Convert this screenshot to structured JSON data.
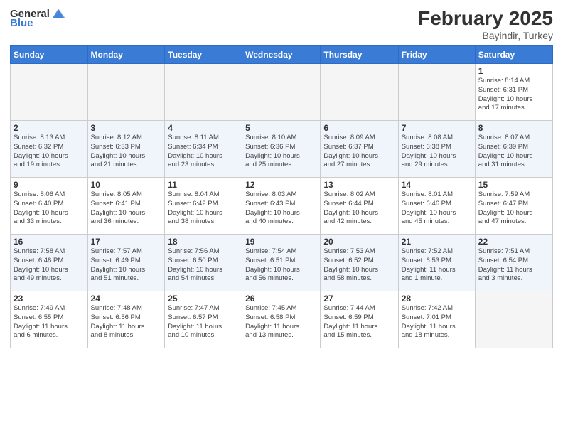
{
  "header": {
    "logo_general": "General",
    "logo_blue": "Blue",
    "title": "February 2025",
    "location": "Bayindir, Turkey"
  },
  "weekdays": [
    "Sunday",
    "Monday",
    "Tuesday",
    "Wednesday",
    "Thursday",
    "Friday",
    "Saturday"
  ],
  "weeks": [
    [
      {
        "day": "",
        "info": ""
      },
      {
        "day": "",
        "info": ""
      },
      {
        "day": "",
        "info": ""
      },
      {
        "day": "",
        "info": ""
      },
      {
        "day": "",
        "info": ""
      },
      {
        "day": "",
        "info": ""
      },
      {
        "day": "1",
        "info": "Sunrise: 8:14 AM\nSunset: 6:31 PM\nDaylight: 10 hours\nand 17 minutes."
      }
    ],
    [
      {
        "day": "2",
        "info": "Sunrise: 8:13 AM\nSunset: 6:32 PM\nDaylight: 10 hours\nand 19 minutes."
      },
      {
        "day": "3",
        "info": "Sunrise: 8:12 AM\nSunset: 6:33 PM\nDaylight: 10 hours\nand 21 minutes."
      },
      {
        "day": "4",
        "info": "Sunrise: 8:11 AM\nSunset: 6:34 PM\nDaylight: 10 hours\nand 23 minutes."
      },
      {
        "day": "5",
        "info": "Sunrise: 8:10 AM\nSunset: 6:36 PM\nDaylight: 10 hours\nand 25 minutes."
      },
      {
        "day": "6",
        "info": "Sunrise: 8:09 AM\nSunset: 6:37 PM\nDaylight: 10 hours\nand 27 minutes."
      },
      {
        "day": "7",
        "info": "Sunrise: 8:08 AM\nSunset: 6:38 PM\nDaylight: 10 hours\nand 29 minutes."
      },
      {
        "day": "8",
        "info": "Sunrise: 8:07 AM\nSunset: 6:39 PM\nDaylight: 10 hours\nand 31 minutes."
      }
    ],
    [
      {
        "day": "9",
        "info": "Sunrise: 8:06 AM\nSunset: 6:40 PM\nDaylight: 10 hours\nand 33 minutes."
      },
      {
        "day": "10",
        "info": "Sunrise: 8:05 AM\nSunset: 6:41 PM\nDaylight: 10 hours\nand 36 minutes."
      },
      {
        "day": "11",
        "info": "Sunrise: 8:04 AM\nSunset: 6:42 PM\nDaylight: 10 hours\nand 38 minutes."
      },
      {
        "day": "12",
        "info": "Sunrise: 8:03 AM\nSunset: 6:43 PM\nDaylight: 10 hours\nand 40 minutes."
      },
      {
        "day": "13",
        "info": "Sunrise: 8:02 AM\nSunset: 6:44 PM\nDaylight: 10 hours\nand 42 minutes."
      },
      {
        "day": "14",
        "info": "Sunrise: 8:01 AM\nSunset: 6:46 PM\nDaylight: 10 hours\nand 45 minutes."
      },
      {
        "day": "15",
        "info": "Sunrise: 7:59 AM\nSunset: 6:47 PM\nDaylight: 10 hours\nand 47 minutes."
      }
    ],
    [
      {
        "day": "16",
        "info": "Sunrise: 7:58 AM\nSunset: 6:48 PM\nDaylight: 10 hours\nand 49 minutes."
      },
      {
        "day": "17",
        "info": "Sunrise: 7:57 AM\nSunset: 6:49 PM\nDaylight: 10 hours\nand 51 minutes."
      },
      {
        "day": "18",
        "info": "Sunrise: 7:56 AM\nSunset: 6:50 PM\nDaylight: 10 hours\nand 54 minutes."
      },
      {
        "day": "19",
        "info": "Sunrise: 7:54 AM\nSunset: 6:51 PM\nDaylight: 10 hours\nand 56 minutes."
      },
      {
        "day": "20",
        "info": "Sunrise: 7:53 AM\nSunset: 6:52 PM\nDaylight: 10 hours\nand 58 minutes."
      },
      {
        "day": "21",
        "info": "Sunrise: 7:52 AM\nSunset: 6:53 PM\nDaylight: 11 hours\nand 1 minute."
      },
      {
        "day": "22",
        "info": "Sunrise: 7:51 AM\nSunset: 6:54 PM\nDaylight: 11 hours\nand 3 minutes."
      }
    ],
    [
      {
        "day": "23",
        "info": "Sunrise: 7:49 AM\nSunset: 6:55 PM\nDaylight: 11 hours\nand 6 minutes."
      },
      {
        "day": "24",
        "info": "Sunrise: 7:48 AM\nSunset: 6:56 PM\nDaylight: 11 hours\nand 8 minutes."
      },
      {
        "day": "25",
        "info": "Sunrise: 7:47 AM\nSunset: 6:57 PM\nDaylight: 11 hours\nand 10 minutes."
      },
      {
        "day": "26",
        "info": "Sunrise: 7:45 AM\nSunset: 6:58 PM\nDaylight: 11 hours\nand 13 minutes."
      },
      {
        "day": "27",
        "info": "Sunrise: 7:44 AM\nSunset: 6:59 PM\nDaylight: 11 hours\nand 15 minutes."
      },
      {
        "day": "28",
        "info": "Sunrise: 7:42 AM\nSunset: 7:01 PM\nDaylight: 11 hours\nand 18 minutes."
      },
      {
        "day": "",
        "info": ""
      }
    ]
  ]
}
